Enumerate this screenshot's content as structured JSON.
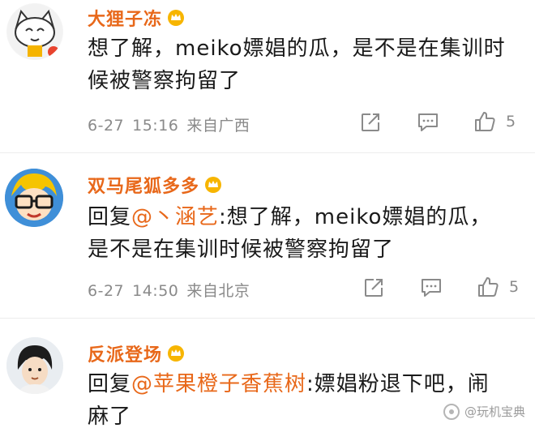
{
  "comments": [
    {
      "username": "大狸子冻",
      "text_line1": "想了解，meiko嫖娼的瓜，是不是在集训时",
      "text_line2": "候被警察拘留了",
      "date": "6-27",
      "time": "15:16",
      "location": "来自广西",
      "like_count": "5"
    },
    {
      "username": "双马尾狐多多",
      "reply_prefix": "回复",
      "mention": "@丶涵艺",
      "text_line1": ":想了解，meiko嫖娼的瓜，",
      "text_line2": "是不是在集训时候被警察拘留了",
      "date": "6-27",
      "time": "14:50",
      "location": "来自北京",
      "like_count": "5"
    },
    {
      "username": "反派登场",
      "reply_prefix": "回复",
      "mention": "@苹果橙子香蕉树",
      "text_line1": ":嫖娼粉退下吧，闹",
      "text_line2": "麻了"
    }
  ],
  "icons": {
    "share": "share-icon",
    "comment": "comment-icon",
    "like": "thumbs-up-icon",
    "badge": "vip-crown-badge-icon"
  },
  "colors": {
    "username": "#e8681a",
    "meta": "#8a8a8a",
    "text": "#1a1a1a"
  },
  "watermark": {
    "text": "@玩机宝典"
  }
}
